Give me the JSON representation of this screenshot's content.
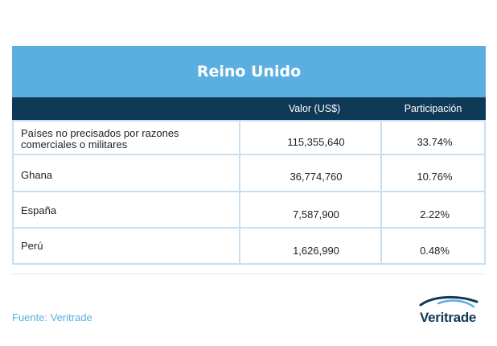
{
  "chart_data": {
    "type": "table",
    "title": "Reino Unido",
    "columns": [
      "",
      "Valor (US$)",
      "Participación"
    ],
    "rows": [
      {
        "country_line1": "Países no precisados por razones",
        "country_line2": "comerciales o militares",
        "value": "115,355,640",
        "share": "33.74%"
      },
      {
        "country": "Ghana",
        "value": "36,774,760",
        "share": "10.76%"
      },
      {
        "country": "España",
        "value": "7,587,900",
        "share": "2.22%"
      },
      {
        "country": "Perú",
        "value": "1,626,990",
        "share": "0.48%"
      }
    ]
  },
  "footer": {
    "source": "Fuente: Veritrade",
    "logo_text": "Veritrade"
  },
  "colors": {
    "title_bg": "#5aaee0",
    "header_bg": "#0f3a57",
    "border": "#c7dff0",
    "source_text": "#5aaee0"
  }
}
